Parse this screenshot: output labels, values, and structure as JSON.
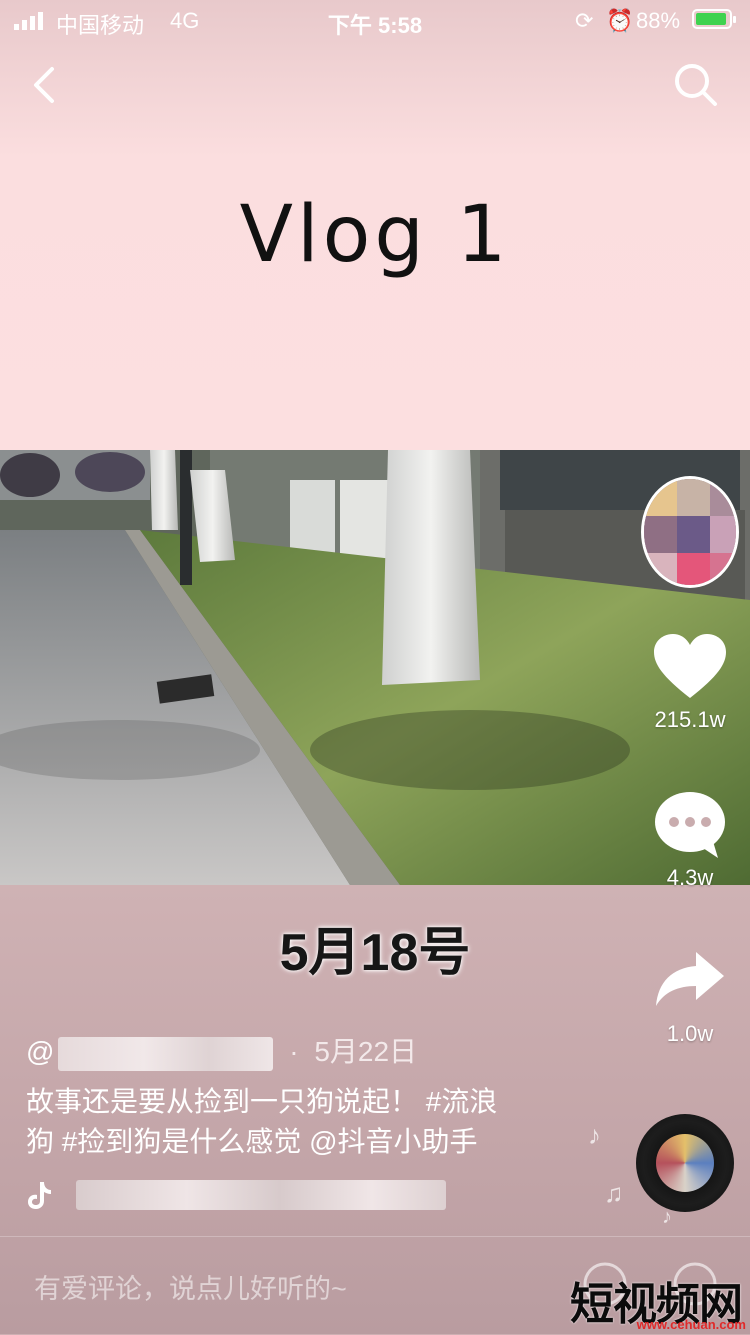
{
  "status_bar": {
    "carrier": "中国移动",
    "network": "4G",
    "time": "下午 5:58",
    "battery": "88%"
  },
  "nav": {
    "back_icon": "chevron-left-icon",
    "search_icon": "search-icon"
  },
  "video": {
    "title_card": "Vlog 1",
    "date_caption": "5月18号"
  },
  "actions": {
    "likes": "215.1w",
    "comments": "4.3w",
    "shares": "1.0w"
  },
  "post": {
    "at": "@",
    "dot": "·",
    "date": "5月22日",
    "description_line1": "故事还是要从捡到一只狗说起！ #流浪",
    "description_line2": "狗 #捡到狗是什么感觉  @抖音小助手"
  },
  "comment_input": {
    "placeholder": "有爱评论，说点儿好听的~"
  },
  "watermark": {
    "brand": "短视频网",
    "url": "www.cehuan.com"
  },
  "colors": {
    "pink_card": "#fcdfe0",
    "battery_green": "#3fd24f",
    "watermark_url": "#e02a2a"
  }
}
